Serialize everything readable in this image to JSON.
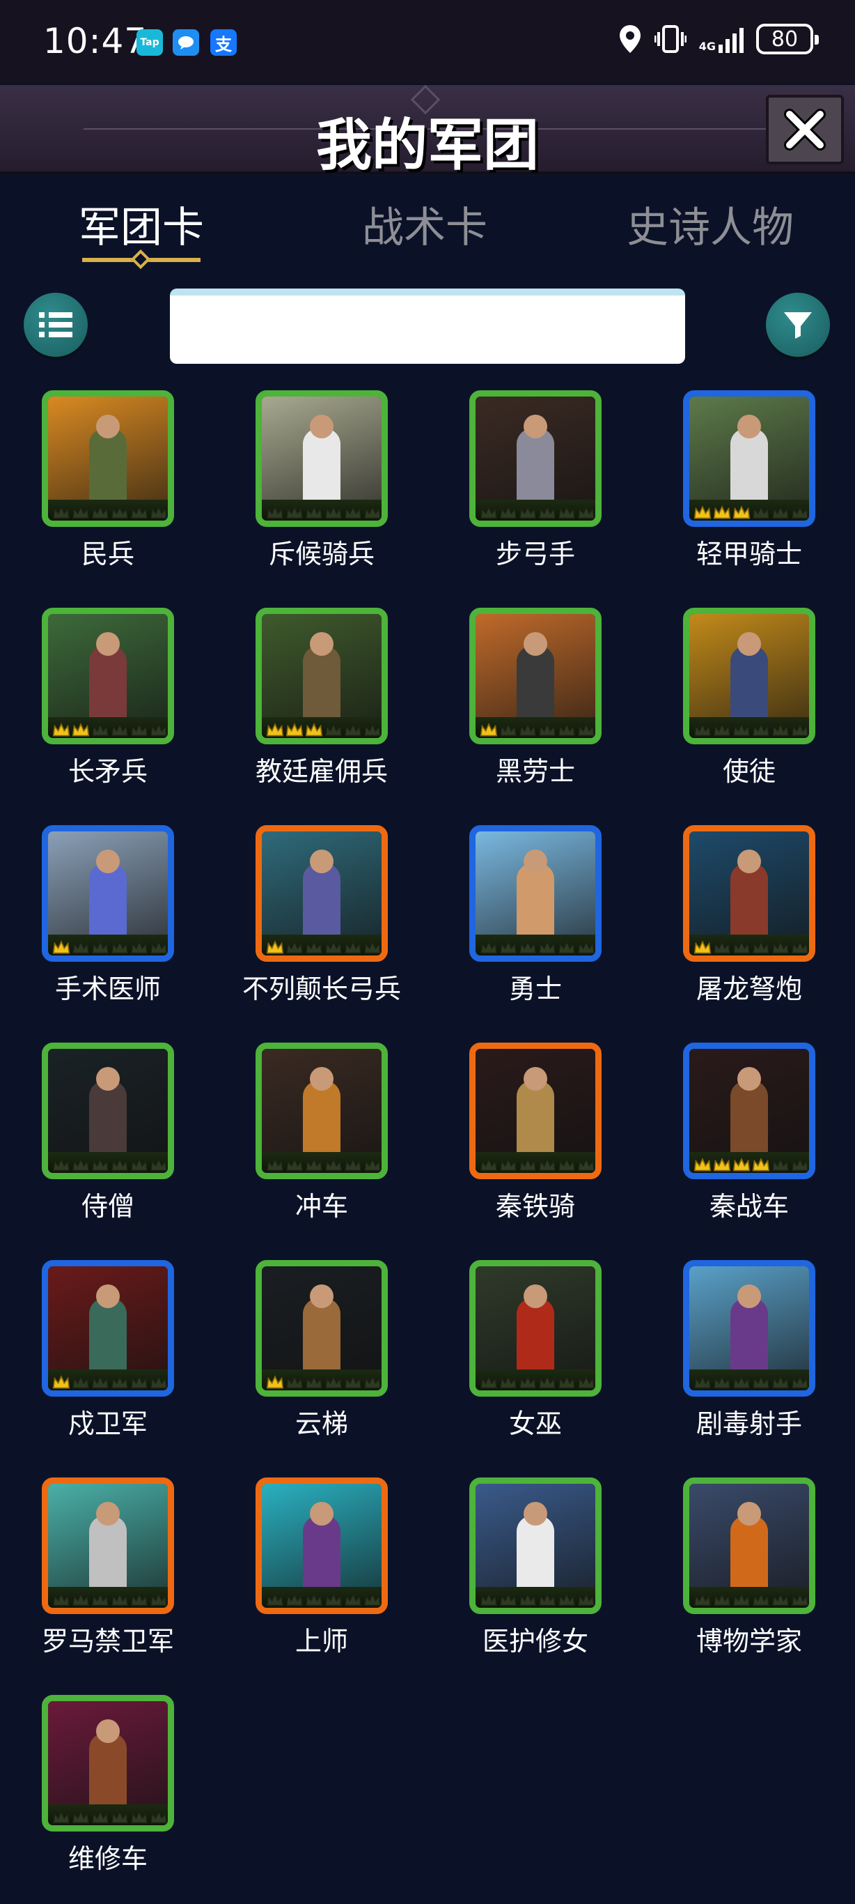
{
  "status_bar": {
    "time": "10:47",
    "apps": [
      {
        "label": "Tap",
        "color": "#1ab8d8"
      },
      {
        "label": "",
        "color": "#1f8ef1"
      },
      {
        "label": "支",
        "color": "#1677ff"
      }
    ],
    "network": "4G",
    "battery": "80"
  },
  "header": {
    "title": "我的军团"
  },
  "tabs": [
    {
      "label": "军团卡",
      "active": true
    },
    {
      "label": "战术卡",
      "active": false
    },
    {
      "label": "史诗人物",
      "active": false
    }
  ],
  "search": {
    "value": "",
    "placeholder": ""
  },
  "cards": [
    {
      "name": "民兵",
      "rarity": "green",
      "crowns": 0,
      "bg": "#d98a22",
      "fig": "#5a6b3a"
    },
    {
      "name": "斥候骑兵",
      "rarity": "green",
      "crowns": 0,
      "bg": "#a8a98f",
      "fig": "#e8e8e8"
    },
    {
      "name": "步弓手",
      "rarity": "green",
      "crowns": 0,
      "bg": "#3b2a23",
      "fig": "#8a8a9a"
    },
    {
      "name": "轻甲骑士",
      "rarity": "blue",
      "crowns": 3,
      "bg": "#5d7a4a",
      "fig": "#d8d8d8"
    },
    {
      "name": "长矛兵",
      "rarity": "green",
      "crowns": 2,
      "bg": "#3d6a3a",
      "fig": "#7a3a3a"
    },
    {
      "name": "教廷雇佣兵",
      "rarity": "green",
      "crowns": 3,
      "bg": "#3f5a2c",
      "fig": "#6f5a3a"
    },
    {
      "name": "黑劳士",
      "rarity": "green",
      "crowns": 1,
      "bg": "#c06a2a",
      "fig": "#3a3a3a"
    },
    {
      "name": "使徒",
      "rarity": "green",
      "crowns": 0,
      "bg": "#c28a1a",
      "fig": "#3a4a7a"
    },
    {
      "name": "手术医师",
      "rarity": "blue",
      "crowns": 1,
      "bg": "#8aa0b8",
      "fig": "#5a6ad0"
    },
    {
      "name": "不列颠长弓兵",
      "rarity": "orange",
      "crowns": 1,
      "bg": "#2f6a7a",
      "fig": "#5a5aa0"
    },
    {
      "name": "勇士",
      "rarity": "blue",
      "crowns": 0,
      "bg": "#7ab8e0",
      "fig": "#d09a6a"
    },
    {
      "name": "屠龙弩炮",
      "rarity": "orange",
      "crowns": 1,
      "bg": "#1e4a6a",
      "fig": "#8a3a2a"
    },
    {
      "name": "侍僧",
      "rarity": "green",
      "crowns": 0,
      "bg": "#1a2226",
      "fig": "#4a3a3a"
    },
    {
      "name": "冲车",
      "rarity": "green",
      "crowns": 0,
      "bg": "#3a2a22",
      "fig": "#c07a2a"
    },
    {
      "name": "秦铁骑",
      "rarity": "orange",
      "crowns": 0,
      "bg": "#2a1a1a",
      "fig": "#b08a4a"
    },
    {
      "name": "秦战车",
      "rarity": "blue",
      "crowns": 4,
      "bg": "#2a1a1a",
      "fig": "#7a4a2a"
    },
    {
      "name": "戍卫军",
      "rarity": "blue",
      "crowns": 1,
      "bg": "#6a1a1a",
      "fig": "#3a6a5a"
    },
    {
      "name": "云梯",
      "rarity": "green",
      "crowns": 1,
      "bg": "#1a1e22",
      "fig": "#9a6a3a"
    },
    {
      "name": "女巫",
      "rarity": "green",
      "crowns": 0,
      "bg": "#2f3a2a",
      "fig": "#b02a1a"
    },
    {
      "name": "剧毒射手",
      "rarity": "blue",
      "crowns": 0,
      "bg": "#5aa0c8",
      "fig": "#6a3a8a"
    },
    {
      "name": "罗马禁卫军",
      "rarity": "orange",
      "crowns": 0,
      "bg": "#4ab0a8",
      "fig": "#c0c0c0"
    },
    {
      "name": "上师",
      "rarity": "orange",
      "crowns": 0,
      "bg": "#2ab0c0",
      "fig": "#6a3a8a"
    },
    {
      "name": "医护修女",
      "rarity": "green",
      "crowns": 0,
      "bg": "#3a5a8a",
      "fig": "#eaeaea"
    },
    {
      "name": "博物学家",
      "rarity": "green",
      "crowns": 0,
      "bg": "#3a4a6a",
      "fig": "#d06a1a"
    },
    {
      "name": "维修车",
      "rarity": "green",
      "crowns": 0,
      "bg": "#6a1a3a",
      "fig": "#8a4a2a"
    }
  ]
}
